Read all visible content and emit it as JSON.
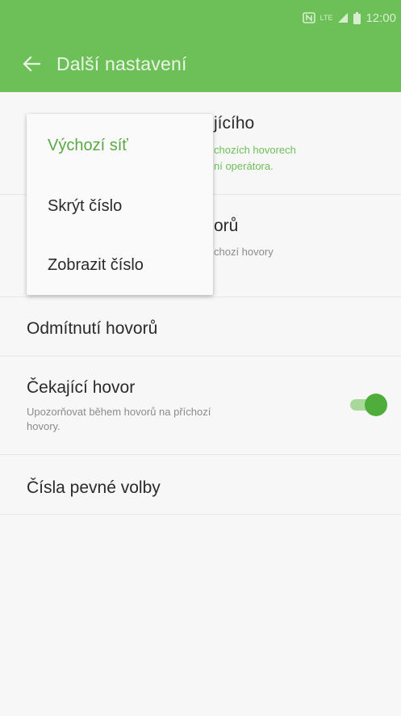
{
  "statusbar": {
    "time": "12:00",
    "icons": [
      "nfc-icon",
      "lte-icon",
      "signal-icon",
      "battery-icon"
    ],
    "lte_label": "LTE"
  },
  "appbar": {
    "title": "Další nastavení",
    "back_icon": "arrow-left-icon",
    "color": "#6dbf57"
  },
  "list": {
    "row1": {
      "title_partial": "jícího",
      "subtitle_line1_partial": "chozích hovorech",
      "subtitle_line2_partial": "ní operátora."
    },
    "row2": {
      "title_partial": "orů",
      "subtitle_partial": "chozí hovory"
    },
    "row3": {
      "title": "Odmítnutí hovorů"
    },
    "row4": {
      "title": "Čekající hovor",
      "subtitle_line1": "Upozorňovat během hovorů na příchozí",
      "subtitle_line2": "hovory.",
      "toggle_on": true
    },
    "row5": {
      "title": "Čísla pevné volby"
    }
  },
  "menu": {
    "items": [
      "Výchozí síť",
      "Skrýt číslo",
      "Zobrazit číslo"
    ],
    "selected_index": 0
  },
  "colors": {
    "accent": "#6dbf57",
    "selected_text": "#5aa844"
  }
}
